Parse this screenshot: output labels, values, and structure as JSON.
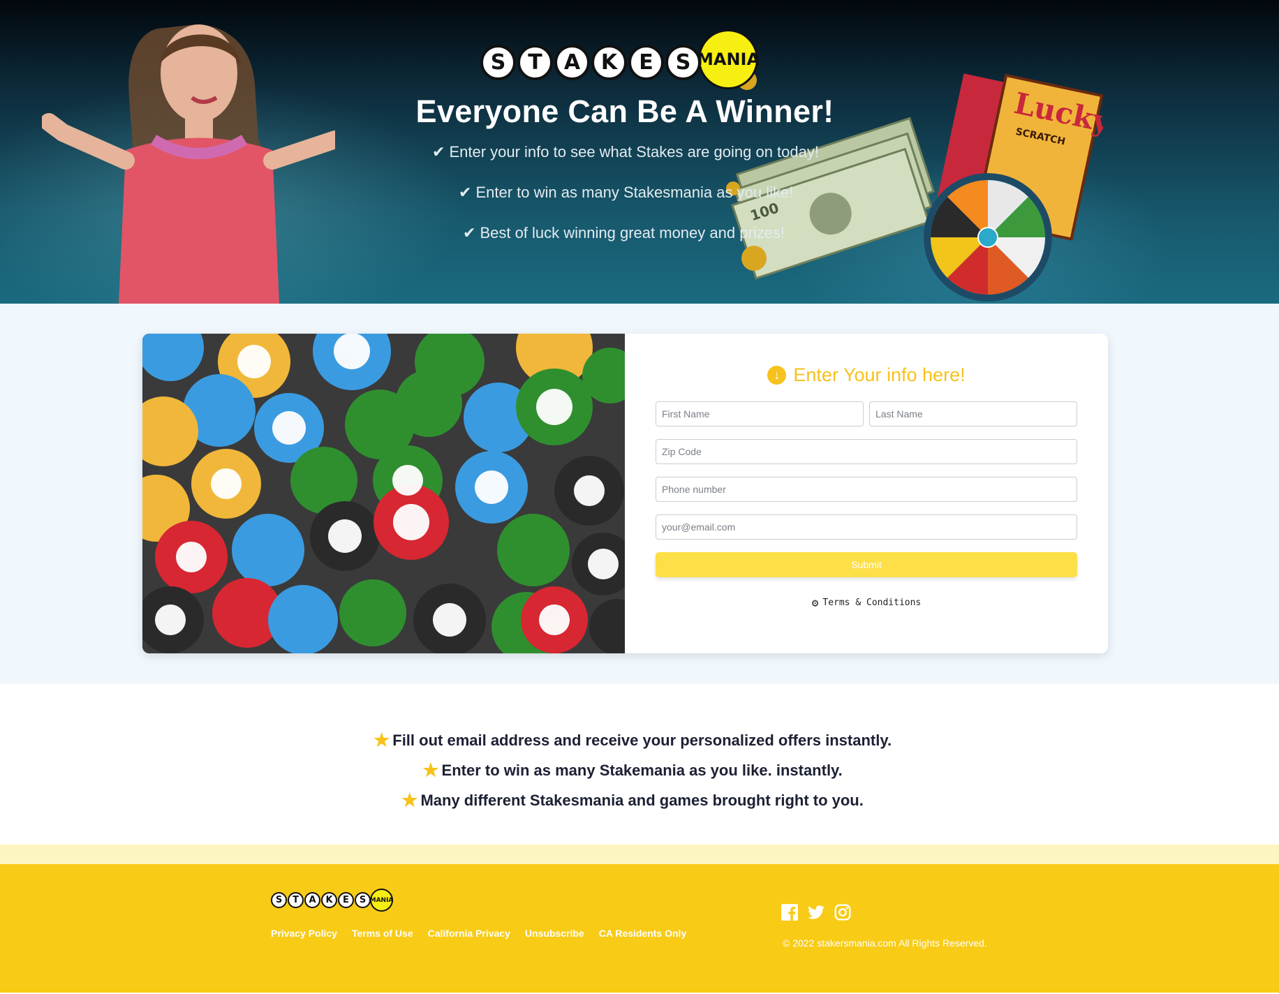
{
  "hero": {
    "logo": {
      "letters": [
        "S",
        "T",
        "A",
        "K",
        "E",
        "S"
      ],
      "mania": "MANIA"
    },
    "title": "Everyone Can Be A Winner!",
    "lines": [
      "Enter your info to see what Stakes are going on today!",
      "Enter to win as many Stakesmania as you like!",
      "Best of luck winning great money and prizes!"
    ]
  },
  "form": {
    "heading": "Enter Your info here!",
    "first_name_placeholder": "First Name",
    "last_name_placeholder": "Last Name",
    "zip_placeholder": "Zip Code",
    "phone_placeholder": "Phone number",
    "email_placeholder": "your@email.com",
    "submit_label": "Submit",
    "terms_label": "Terms & Conditions"
  },
  "features": [
    "Fill out email address and receive your personalized offers instantly.",
    "Enter to win as many Stakemania as you like. instantly.",
    "Many different Stakesmania and games brought right to you."
  ],
  "footer": {
    "logo": {
      "letters": [
        "S",
        "T",
        "A",
        "K",
        "E",
        "S"
      ],
      "mania": "MANIA"
    },
    "links": [
      "Privacy Policy",
      "Terms of Use",
      "California Privacy",
      "Unsubscribe",
      "CA Residents Only"
    ],
    "social_icons": [
      "facebook-icon",
      "twitter-icon",
      "instagram-icon"
    ],
    "copyright": "© 2022 stakersmania.com All Rights Reserved."
  },
  "colors": {
    "accent_yellow": "#f6c21b",
    "footer_yellow": "#f8cb16",
    "submit_yellow": "#fddf47",
    "form_bg": "#f0f7fd"
  }
}
